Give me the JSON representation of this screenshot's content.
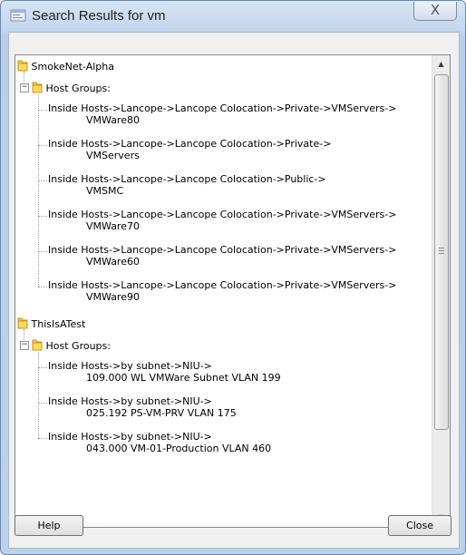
{
  "window": {
    "title": "Search Results for vm",
    "close_glyph": "X"
  },
  "tree": {
    "domains": [
      {
        "name": "SmokeNet-Alpha",
        "group_label": "Host Groups:",
        "results": [
          {
            "line1": "Inside Hosts->Lancope->Lancope Colocation->Private->VMServers->",
            "line2": "VMWare80"
          },
          {
            "line1": "Inside Hosts->Lancope->Lancope Colocation->Private->",
            "line2": "VMServers"
          },
          {
            "line1": "Inside Hosts->Lancope->Lancope Colocation->Public->",
            "line2": "VMSMC"
          },
          {
            "line1": "Inside Hosts->Lancope->Lancope Colocation->Private->VMServers->",
            "line2": "VMWare70"
          },
          {
            "line1": "Inside Hosts->Lancope->Lancope Colocation->Private->VMServers->",
            "line2": "VMWare60"
          },
          {
            "line1": "Inside Hosts->Lancope->Lancope Colocation->Private->VMServers->",
            "line2": "VMWare90"
          }
        ]
      },
      {
        "name": "ThisIsATest",
        "group_label": "Host Groups:",
        "results": [
          {
            "line1": "Inside Hosts->by subnet->NIU->",
            "line2": "109.000 WL VMWare Subnet VLAN 199"
          },
          {
            "line1": "Inside Hosts->by subnet->NIU->",
            "line2": "025.192 PS-VM-PRV VLAN 175"
          },
          {
            "line1": "Inside Hosts->by subnet->NIU->",
            "line2": "043.000 VM-01-Production VLAN 460"
          }
        ]
      }
    ],
    "expander_glyph": "−"
  },
  "buttons": {
    "help": "Help",
    "close": "Close"
  },
  "scroll": {
    "position_fraction": 0.0
  }
}
